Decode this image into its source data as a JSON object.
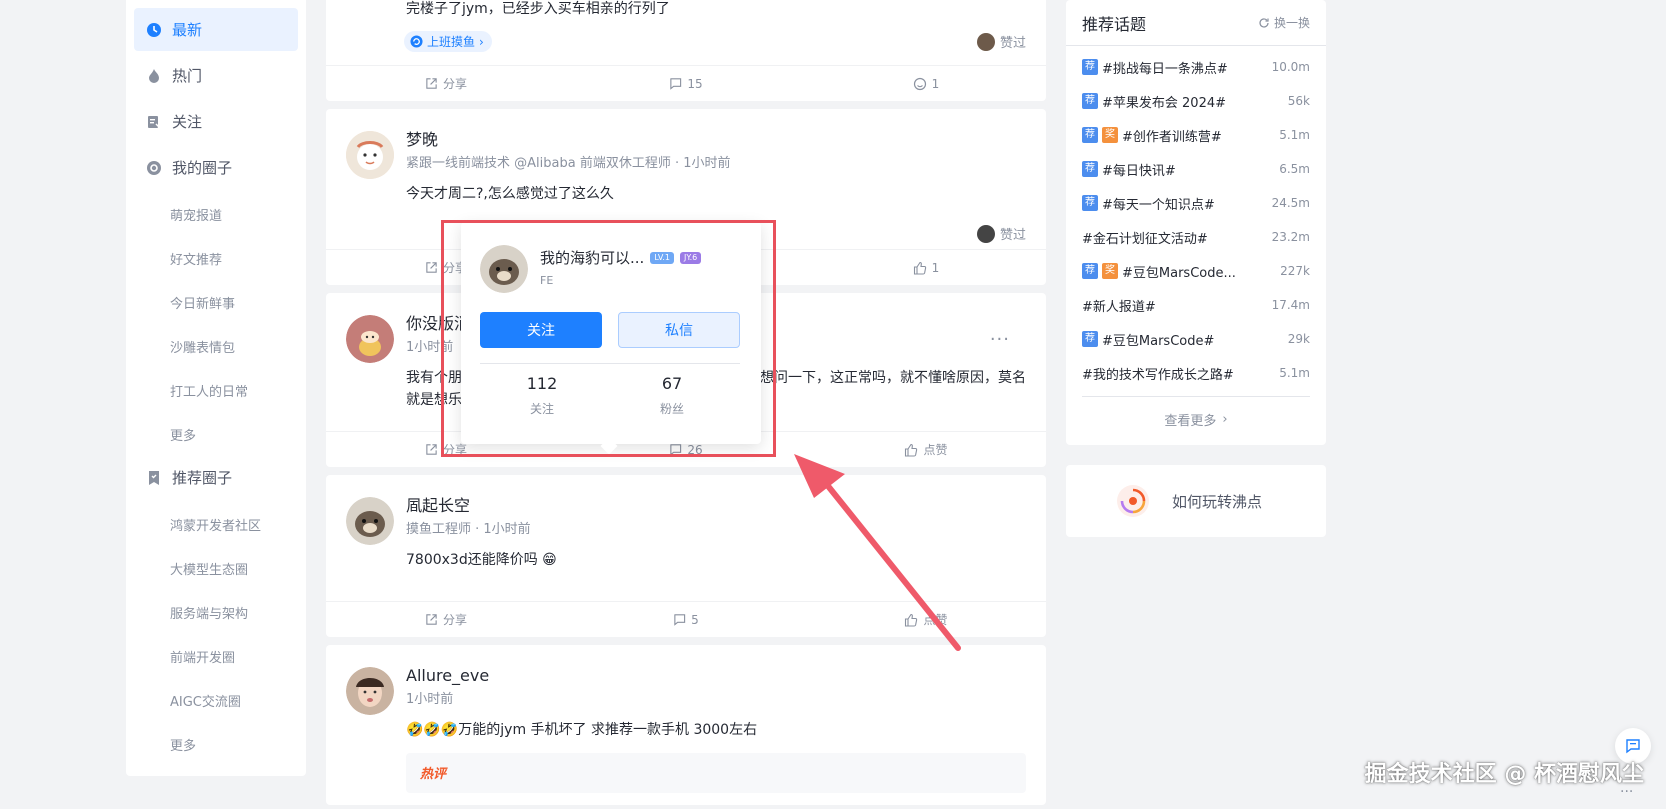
{
  "sidebar": {
    "nav": [
      {
        "label": "最新",
        "icon": "clock-icon"
      },
      {
        "label": "热门",
        "icon": "fire-icon"
      },
      {
        "label": "关注",
        "icon": "follow-icon"
      },
      {
        "label": "我的圈子",
        "icon": "circle-icon"
      }
    ],
    "my_circles": [
      "萌宠报道",
      "好文推荐",
      "今日新鲜事",
      "沙雕表情包",
      "打工人的日常",
      "更多"
    ],
    "recommend_title": "推荐圈子",
    "recommend_circles": [
      "鸿蒙开发者社区",
      "大模型生态圈",
      "服务端与架构",
      "前端开发圈",
      "AIGC交流圈",
      "更多"
    ]
  },
  "feed": {
    "post0": {
      "content": "完楼子了jym，已经步入买车相亲的行列了",
      "topic": "上班摸鱼",
      "zan": "赞过",
      "share": "分享",
      "comments": "15",
      "likes": "1"
    },
    "post1": {
      "name": "梦晚",
      "meta": "紧跟一线前端技术 @Alibaba 前端双休工程师 · 1小时前",
      "content": "今天才周二?,怎么感觉过了这么久",
      "zan": "赞过",
      "share": "分享",
      "likes": "1"
    },
    "post2": {
      "name": "你没版消",
      "meta": "1小时前",
      "content_line1": "我有个朋",
      "content_tail1": "想问一下，这正常吗，就不懂啥原因，莫名",
      "content_line2": "就是想乐",
      "share": "分享",
      "comments": "26",
      "like": "点赞"
    },
    "post3": {
      "name": "凮起长空",
      "meta": "摸鱼工程师 · 1小时前",
      "content": "7800x3d还能降价吗",
      "emoji": "😁",
      "share": "分享",
      "comments": "5",
      "like": "点赞"
    },
    "post4": {
      "name": "Allure_eve",
      "meta": "1小时前",
      "emoji": "🤣🤣🤣",
      "content": "万能的jym 手机坏了 求推荐一款手机 3000左右",
      "hot_label": "热评"
    }
  },
  "popup": {
    "name": "我的海豹可以...",
    "lv": "LV.1",
    "jy": "JY.6",
    "job": "FE",
    "follow_btn": "关注",
    "msg_btn": "私信",
    "following_count": "112",
    "following_label": "关注",
    "fans_count": "67",
    "fans_label": "粉丝"
  },
  "right": {
    "title": "推荐话题",
    "refresh": "换一换",
    "topics": [
      {
        "name": "#挑战每日一条沸点#",
        "count": "10.0m",
        "rec": true,
        "award": false
      },
      {
        "name": "#苹果发布会 2024#",
        "count": "56k",
        "rec": true,
        "award": false
      },
      {
        "name": "#创作者训练营#",
        "count": "5.1m",
        "rec": true,
        "award": true
      },
      {
        "name": "#每日快讯#",
        "count": "6.5m",
        "rec": true,
        "award": false
      },
      {
        "name": "#每天一个知识点#",
        "count": "24.5m",
        "rec": true,
        "award": false
      },
      {
        "name": "#金石计划征文活动#",
        "count": "23.2m",
        "rec": false,
        "award": false
      },
      {
        "name": "#豆包MarsCode...",
        "count": "227k",
        "rec": true,
        "award": true
      },
      {
        "name": "#新人报道#",
        "count": "17.4m",
        "rec": false,
        "award": false
      },
      {
        "name": "#豆包MarsCode#",
        "count": "29k",
        "rec": true,
        "award": false
      },
      {
        "name": "#我的技术写作成长之路#",
        "count": "5.1m",
        "rec": false,
        "award": false
      }
    ],
    "tag_rec": "荐",
    "tag_award": "奖",
    "more": "查看更多",
    "howto": "如何玩转沸点"
  },
  "watermark": "掘金技术社区 @ 杯酒慰风尘",
  "colors": {
    "accent": "#1e80ff",
    "highlight_box": "#e8505b",
    "arrow": "#ef5a6a"
  }
}
